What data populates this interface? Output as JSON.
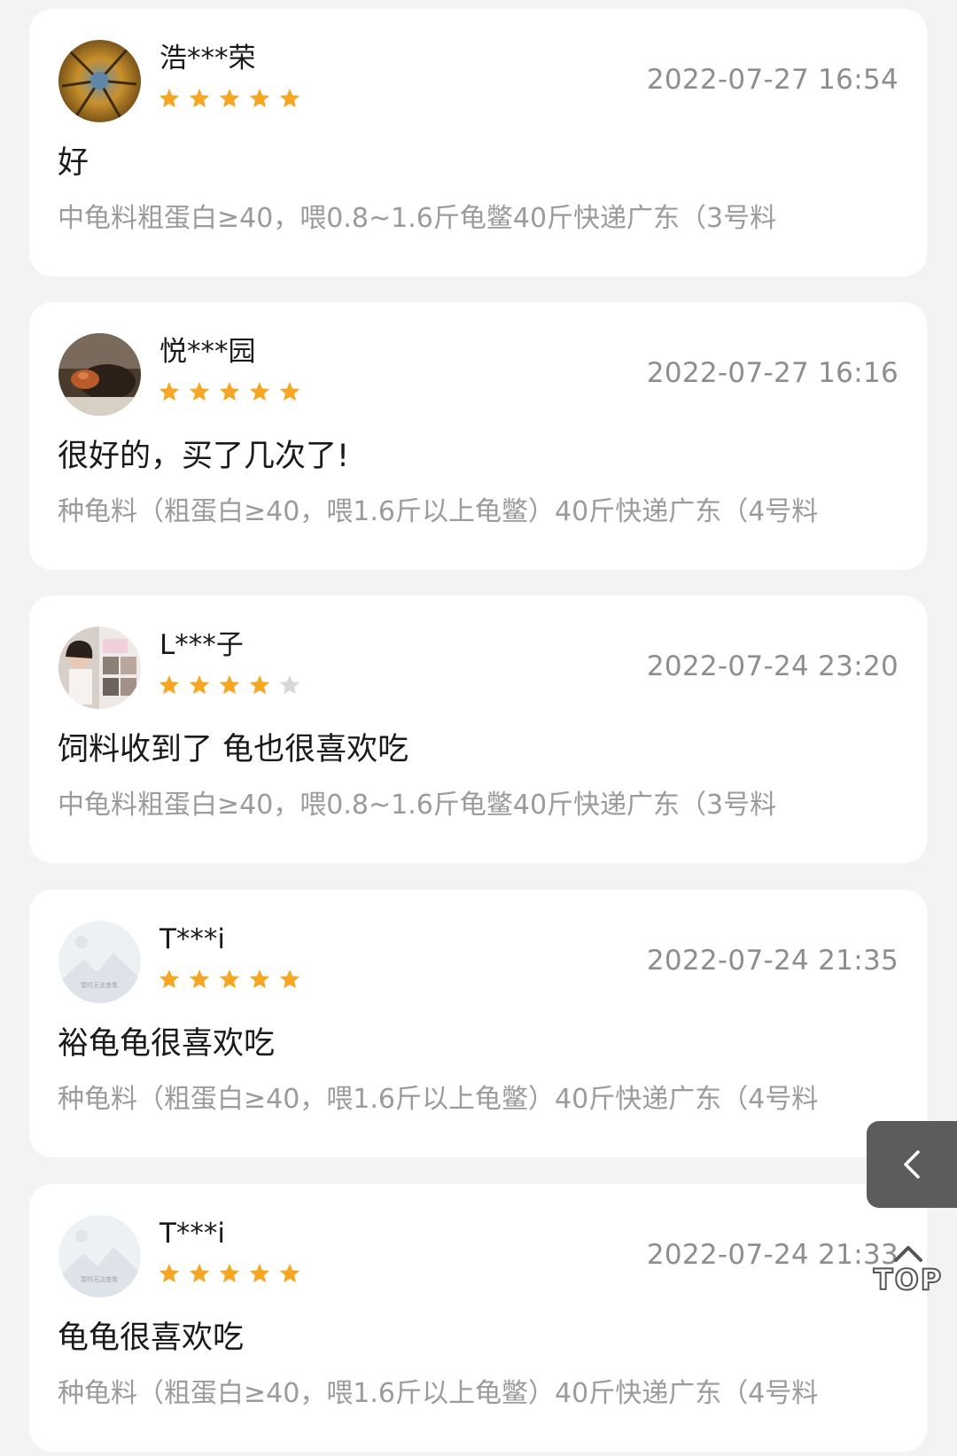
{
  "reviews": [
    {
      "username": "浩***荣",
      "rating": 5,
      "time": "2022-07-27 16:54",
      "content": "好",
      "sku": "中龟料粗蛋白≥40，喂0.8~1.6斤龟鳖40斤快递广东（3号料",
      "avatar": "avatar-tree"
    },
    {
      "username": "悦***园",
      "rating": 5,
      "time": "2022-07-27 16:16",
      "content": "很好的，买了几次了!",
      "sku": "种龟料（粗蛋白≥40，喂1.6斤以上龟鳖）40斤快递广东（4号料",
      "avatar": "avatar-turtle"
    },
    {
      "username": "L***子",
      "rating": 4,
      "time": "2022-07-24 23:20",
      "content": "饲料收到了 龟也很喜欢吃",
      "sku": "中龟料粗蛋白≥40，喂0.8~1.6斤龟鳖40斤快递广东（3号料",
      "avatar": "avatar-person"
    },
    {
      "username": "T***i",
      "rating": 5,
      "time": "2022-07-24 21:35",
      "content": "裕龟龟很喜欢吃",
      "sku": "种龟料（粗蛋白≥40，喂1.6斤以上龟鳖）40斤快递广东（4号料",
      "avatar": "avatar-placeholder"
    },
    {
      "username": "T***i",
      "rating": 5,
      "time": "2022-07-24 21:33",
      "content": "龟龟很喜欢吃",
      "sku": "种龟料（粗蛋白≥40，喂1.6斤以上龟鳖）40斤快递广东（4号料",
      "avatar": "avatar-placeholder"
    }
  ],
  "placeholder_avatar_text": "暂时无法查看",
  "floating": {
    "back_icon": "chevron-left-icon",
    "top_label": "TOP",
    "top_icon": "chevron-up-icon"
  },
  "colors": {
    "star_active": "#f5a623",
    "star_inactive": "#d8d8d8",
    "time_text": "#8e8e8e",
    "sku_text": "#9b9b9b"
  }
}
